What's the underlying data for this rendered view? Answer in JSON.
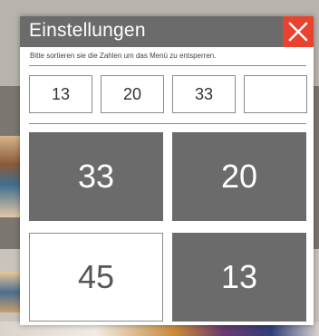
{
  "dialog": {
    "title": "Einstellungen",
    "subtitle": "Bitte sortieren sie die Zahlen um das Menü zu entsperren.",
    "close_icon": "close-x-icon"
  },
  "slots": [
    "13",
    "20",
    "33",
    ""
  ],
  "tiles": [
    {
      "value": "33",
      "state": "used"
    },
    {
      "value": "20",
      "state": "used"
    },
    {
      "value": "45",
      "state": "available"
    },
    {
      "value": "13",
      "state": "used"
    }
  ],
  "colors": {
    "titlebar": "#6b6b6b",
    "close": "#e8432f",
    "tile_used": "#6b6b6b",
    "tile_available": "#ffffff"
  }
}
